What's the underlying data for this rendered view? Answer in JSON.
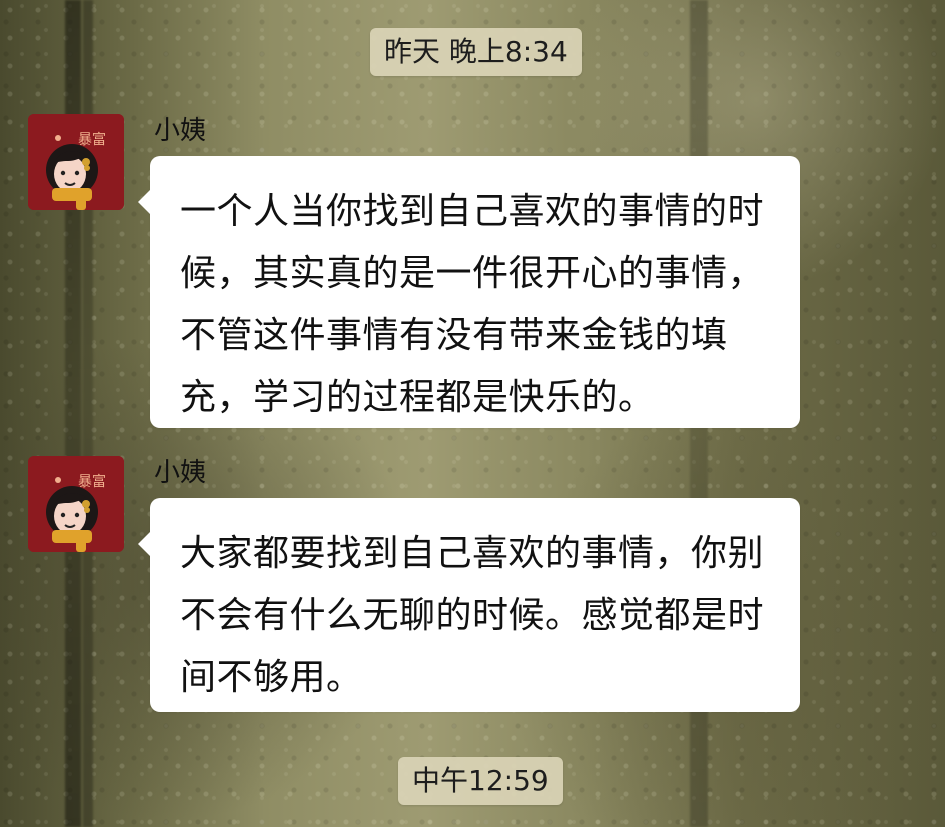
{
  "chat": {
    "time_top": "昨天 晚上8:34",
    "time_bottom": "中午12:59",
    "messages": [
      {
        "sender": "小姨",
        "avatar_text": "暴富",
        "text": "一个人当你找到自己喜欢的事情的时候，其实真的是一件很开心的事情，不管这件事情有没有带来金钱的填充，学习的过程都是快乐的。"
      },
      {
        "sender": "小姨",
        "avatar_text": "暴富",
        "text": "大家都要找到自己喜欢的事情，你别不会有什么无聊的时候。感觉都是时间不够用。"
      }
    ]
  },
  "colors": {
    "avatar_background": "#8c1a1f",
    "avatar_hair": "#1d1716",
    "avatar_face": "#f5d5c7",
    "avatar_scarf": "#e0a22b",
    "bubble": "#ffffff",
    "time_pill": "#dad4b6"
  },
  "icons": {
    "avatar": "cartoon-girl-avatar-icon",
    "bubble_tail": "chat-bubble-tail"
  }
}
